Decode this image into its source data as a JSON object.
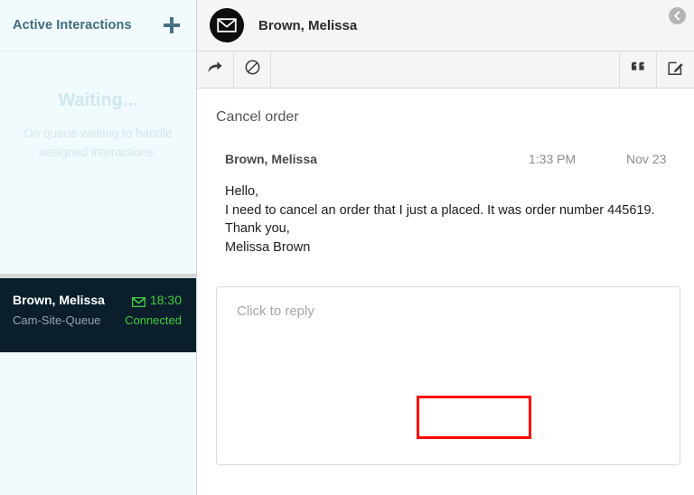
{
  "sidebar": {
    "title": "Active Interactions",
    "add_icon": "plus-icon",
    "waiting": {
      "title": "Waiting...",
      "subtitle": "On queue waiting to handle assigned interactions."
    },
    "interaction": {
      "name": "Brown, Melissa",
      "timer": "18:30",
      "queue": "Cam-Site-Queue",
      "status": "Connected",
      "channel_icon": "envelope-icon",
      "status_color": "#3fce3f"
    }
  },
  "header": {
    "avatar_icon": "envelope-icon",
    "title": "Brown, Melissa",
    "collapse_icon": "chevron-left-icon"
  },
  "toolbar": {
    "forward_icon": "forward-arrow-icon",
    "block_icon": "block-circle-slash-icon",
    "quote_icon": "quote-marks-icon",
    "compose_icon": "compose-pencil-icon"
  },
  "message": {
    "subject": "Cancel order",
    "sender": "Brown, Melissa",
    "time": "1:33 PM",
    "date": "Nov 23",
    "body_lines": [
      "Hello,",
      "I need to cancel an order that I just a placed. It was order number 445619.",
      "Thank you,",
      "Melissa Brown"
    ]
  },
  "reply": {
    "placeholder": "Click to reply",
    "highlight_color": "#ff0000"
  }
}
